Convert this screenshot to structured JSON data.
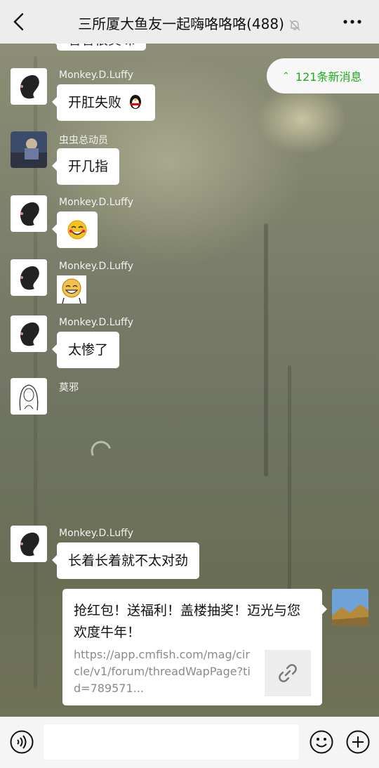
{
  "header": {
    "title": "三所厦大鱼友一起嗨咯咯咯(488)",
    "back_icon": "back-chevron-icon",
    "mute_icon": "bell-off-icon",
    "more_icon": "more-dots-icon"
  },
  "new_messages": {
    "label": "121条新消息",
    "icon": "double-chevron-up-icon"
  },
  "messages": [
    {
      "sender": "Monkey.D.Luffy",
      "text": "开肛失败",
      "emoji": "penguin-emoji"
    },
    {
      "sender": "虫虫总动员",
      "text": "开几指"
    },
    {
      "sender": "Monkey.D.Luffy",
      "emoji": "smile-emoji"
    },
    {
      "sender": "Monkey.D.Luffy",
      "emoji": "laughing-sticker"
    },
    {
      "sender": "Monkey.D.Luffy",
      "text": "太惨了"
    },
    {
      "sender": "莫邪"
    },
    {
      "sender": "Monkey.D.Luffy",
      "text": "长着长着就不太对劲"
    }
  ],
  "link_card": {
    "title": "抢红包！送福利！盖楼抽奖！迈光与您欢度牛年！",
    "url": "https://app.cmfish.com/mag/circle/v1/forum/threadWapPage?tid=789571...",
    "link_icon": "link-icon"
  },
  "bottom_bar": {
    "voice_icon": "voice-icon",
    "emoji_icon": "emoji-icon",
    "plus_icon": "plus-icon",
    "input_value": ""
  },
  "colors": {
    "accent": "#1aad19",
    "header_bg": "#ededed"
  }
}
